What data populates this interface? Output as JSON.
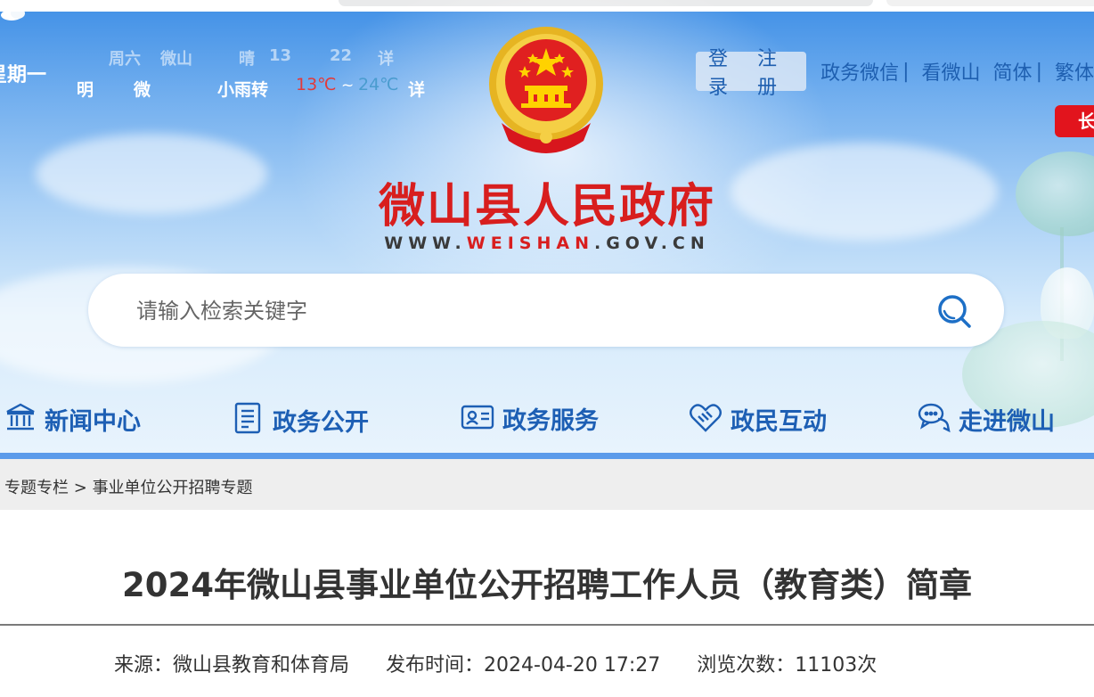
{
  "weather": {
    "faded_row": [
      "周六",
      "微山",
      "晴",
      "13",
      "22",
      "详"
    ],
    "weekday": "星期一",
    "forecast_day": "明",
    "location": "微",
    "condition": "小雨转",
    "temp_high": "13℃",
    "tilde": "~",
    "temp_low": "24℃",
    "detail": "详"
  },
  "top_nav": {
    "login": "登录",
    "register": "注册",
    "links": [
      "政务微信",
      "看微山",
      "简体",
      "繁体"
    ],
    "separator": "|"
  },
  "elder_badge": "长",
  "site": {
    "title": "微山县人民政府",
    "url_prefix": "WWW.",
    "url_highlight": "WEISHAN",
    "url_suffix": ".GOV.CN"
  },
  "search": {
    "placeholder": "请输入检索关键字",
    "value": ""
  },
  "main_nav": [
    {
      "label": "新闻中心",
      "icon": "building-icon"
    },
    {
      "label": "政务公开",
      "icon": "document-icon"
    },
    {
      "label": "政务服务",
      "icon": "id-card-icon"
    },
    {
      "label": "政民互动",
      "icon": "handshake-icon"
    },
    {
      "label": "走进微山",
      "icon": "chat-icon"
    }
  ],
  "breadcrumb": {
    "items": [
      "专题专栏",
      "事业单位公开招聘专题"
    ],
    "separator": ">"
  },
  "article": {
    "title": "2024年微山县事业单位公开招聘工作人员（教育类）简章",
    "source": "来源：微山县教育和体育局",
    "published": "发布时间：2024-04-20 17:27",
    "views": "浏览次数：11103次"
  },
  "colors": {
    "brand_red": "#d81e1e",
    "nav_blue": "#1d5fb4",
    "accent_blue": "#5b9bea"
  }
}
